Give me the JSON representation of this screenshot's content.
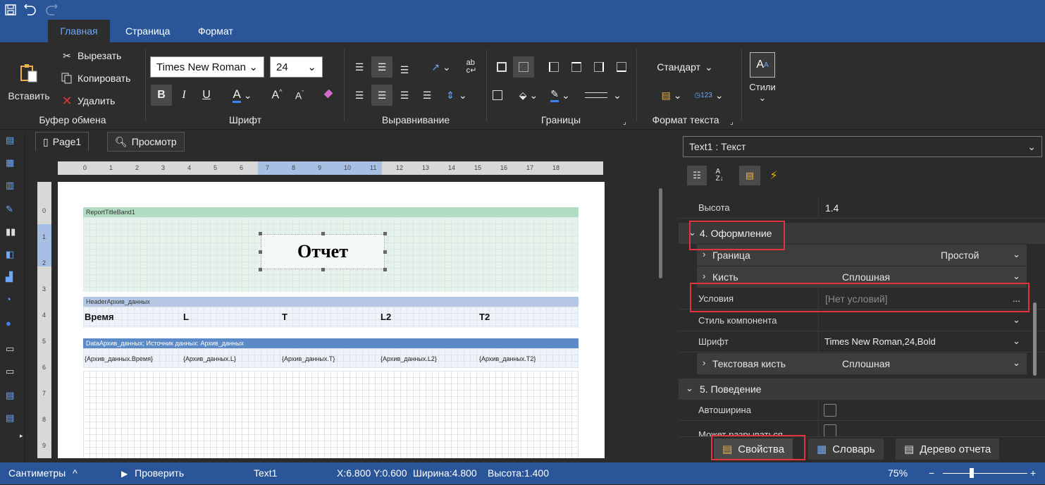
{
  "ribbon_tabs": [
    "Главная",
    "Страница",
    "Формат"
  ],
  "clipboard": {
    "paste": "Вставить",
    "cut": "Вырезать",
    "copy": "Копировать",
    "delete": "Удалить",
    "group": "Буфер обмена"
  },
  "font": {
    "name": "Times New Roman",
    "size": "24",
    "group": "Шрифт",
    "bold": "B",
    "italic": "I",
    "underline": "U"
  },
  "alignment": {
    "group": "Выравнивание"
  },
  "borders": {
    "group": "Границы"
  },
  "textformat": {
    "value": "Стандарт",
    "group": "Формат текста"
  },
  "styles": {
    "label": "Стили"
  },
  "designer_tabs": [
    "Page1",
    "Просмотр"
  ],
  "ruler_ticks": [
    "0",
    "1",
    "2",
    "3",
    "4",
    "5",
    "6",
    "7",
    "8",
    "9",
    "10",
    "11",
    "12",
    "13",
    "14",
    "15",
    "16",
    "17",
    "18"
  ],
  "vruler_ticks": [
    "0",
    "1",
    "2",
    "3",
    "4",
    "5",
    "6",
    "7",
    "8",
    "9"
  ],
  "report": {
    "title_band": "ReportTitleBand1",
    "title_text": "Отчет",
    "header_band": "HeaderАрхив_данных",
    "headers": [
      "Время",
      "L",
      "T",
      "L2",
      "T2"
    ],
    "data_band": "DataАрхив_данных; Источник данных: Архив_данных",
    "fields": [
      "{Архив_данных.Время}",
      "{Архив_данных.L}",
      "{Архив_данных.T}",
      "{Архив_данных.L2}",
      "{Архив_данных.T2}"
    ]
  },
  "props": {
    "component": "Text1 : Текст",
    "height_label": "Высота",
    "height_value": "1.4",
    "cat4": "4. Оформление",
    "border_label": "Граница",
    "border_value": "Простой",
    "brush_label": "Кисть",
    "brush_value": "Сплошная",
    "conditions_label": "Условия",
    "conditions_value": "[Нет условий]",
    "conditions_btn": "...",
    "style_label": "Стиль компонента",
    "style_value": "",
    "font_label": "Шрифт",
    "font_value": "Times New Roman,24,Bold",
    "textbrush_label": "Текстовая кисть",
    "textbrush_value": "Сплошная",
    "cat5": "5. Поведение",
    "autowidth_label": "Автоширина",
    "canbreak_label": "Может разрываться"
  },
  "bottom_tabs": [
    "Свойства",
    "Словарь",
    "Дерево отчета"
  ],
  "status": {
    "units": "Сантиметры",
    "check": "Проверить",
    "component": "Text1",
    "x": "X:6.800",
    "y": "Y:0.600",
    "width": "Ширина:4.800",
    "height": "Высота:1.400",
    "zoom": "75%"
  },
  "colors": {
    "accent": "#2a5699",
    "highlight": "#e0353b",
    "title_band": "#b2dcc4",
    "header_band": "#b5c7e3",
    "data_band": "#5b8ac7"
  }
}
